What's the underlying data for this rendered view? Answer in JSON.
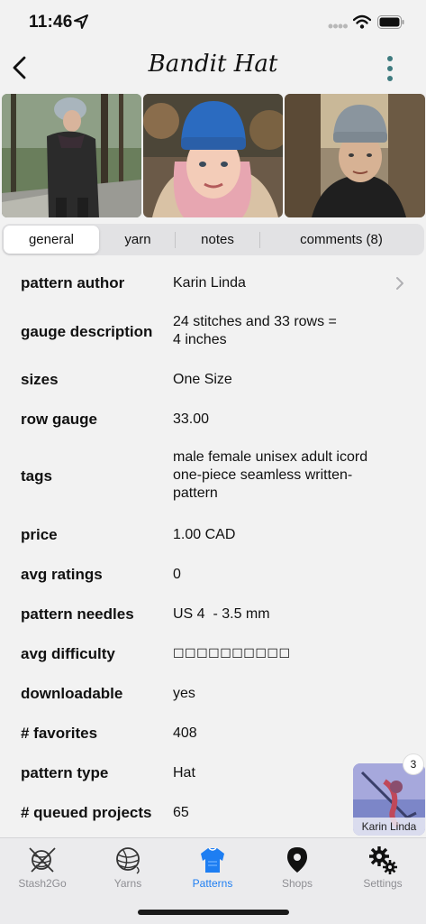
{
  "status_bar": {
    "time": "11:46"
  },
  "nav": {
    "title": "Bandit Hat",
    "back_icon": "chevron-left-icon",
    "more_icon": "vertical-ellipsis-icon",
    "accent": "#3e7b7f"
  },
  "photos": [
    {
      "name": "photo-woman-park"
    },
    {
      "name": "photo-blue-hat-selfie"
    },
    {
      "name": "photo-grey-hat-tree"
    }
  ],
  "tabs": [
    {
      "label": "general",
      "active": true
    },
    {
      "label": "yarn",
      "active": false
    },
    {
      "label": "notes",
      "active": false
    },
    {
      "label": "comments (8)",
      "active": false
    }
  ],
  "details": [
    {
      "label": "pattern author",
      "value": "Karin Linda"
    },
    {
      "label": "gauge description",
      "value": "24 stitches and 33 rows =\n4 inches"
    },
    {
      "label": "sizes",
      "value": "One Size"
    },
    {
      "label": "row gauge",
      "value": "33.00"
    },
    {
      "label": "tags",
      "value": "male female unisex adult icord one-piece seamless written-pattern"
    },
    {
      "label": "price",
      "value": "1.00 CAD"
    },
    {
      "label": "avg ratings",
      "value": "0"
    },
    {
      "label": "pattern needles",
      "value": "US 4  - 3.5 mm"
    },
    {
      "label": "avg difficulty",
      "value": "☐☐☐☐☐☐☐☐☐☐",
      "rating_filled": 0,
      "rating_max": 10
    },
    {
      "label": "downloadable",
      "value": "yes"
    },
    {
      "label": "# favorites",
      "value": "408"
    },
    {
      "label": "pattern type",
      "value": "Hat"
    },
    {
      "label": "# queued projects",
      "value": "65"
    }
  ],
  "floating_thumb": {
    "caption": "Karin Linda",
    "badge": "3"
  },
  "bottom_tabs": [
    {
      "label": "Stash2Go",
      "icon": "yarn-ball-needles-icon",
      "active": false
    },
    {
      "label": "Yarns",
      "icon": "yarn-ball-icon",
      "active": false
    },
    {
      "label": "Patterns",
      "icon": "sweater-icon",
      "active": true
    },
    {
      "label": "Shops",
      "icon": "shop-pin-icon",
      "active": false
    },
    {
      "label": "Settings",
      "icon": "gears-icon",
      "active": false
    }
  ],
  "colors": {
    "active_tab": "#1e7ef2",
    "inactive_tab": "#8e8e93",
    "background": "#f2f2f2"
  }
}
